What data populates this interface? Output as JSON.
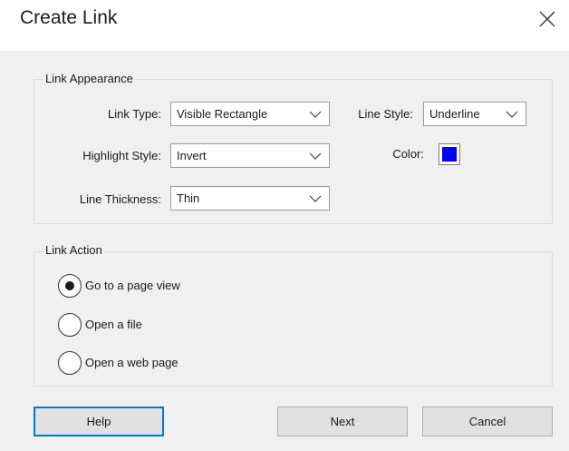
{
  "dialog": {
    "title": "Create Link",
    "close_icon": "close-icon"
  },
  "appearance": {
    "group_title": "Link Appearance",
    "link_type_label": "Link Type:",
    "link_type_value": "Visible Rectangle",
    "line_style_label": "Line Style:",
    "line_style_value": "Underline",
    "highlight_style_label": "Highlight Style:",
    "highlight_style_value": "Invert",
    "color_label": "Color:",
    "color_value": "#0000ff",
    "line_thickness_label": "Line Thickness:",
    "line_thickness_value": "Thin"
  },
  "action": {
    "group_title": "Link Action",
    "options": [
      {
        "label": "Go to a page view",
        "selected": true
      },
      {
        "label": "Open a file",
        "selected": false
      },
      {
        "label": "Open a web page",
        "selected": false
      }
    ]
  },
  "buttons": {
    "help": "Help",
    "next": "Next",
    "cancel": "Cancel"
  }
}
